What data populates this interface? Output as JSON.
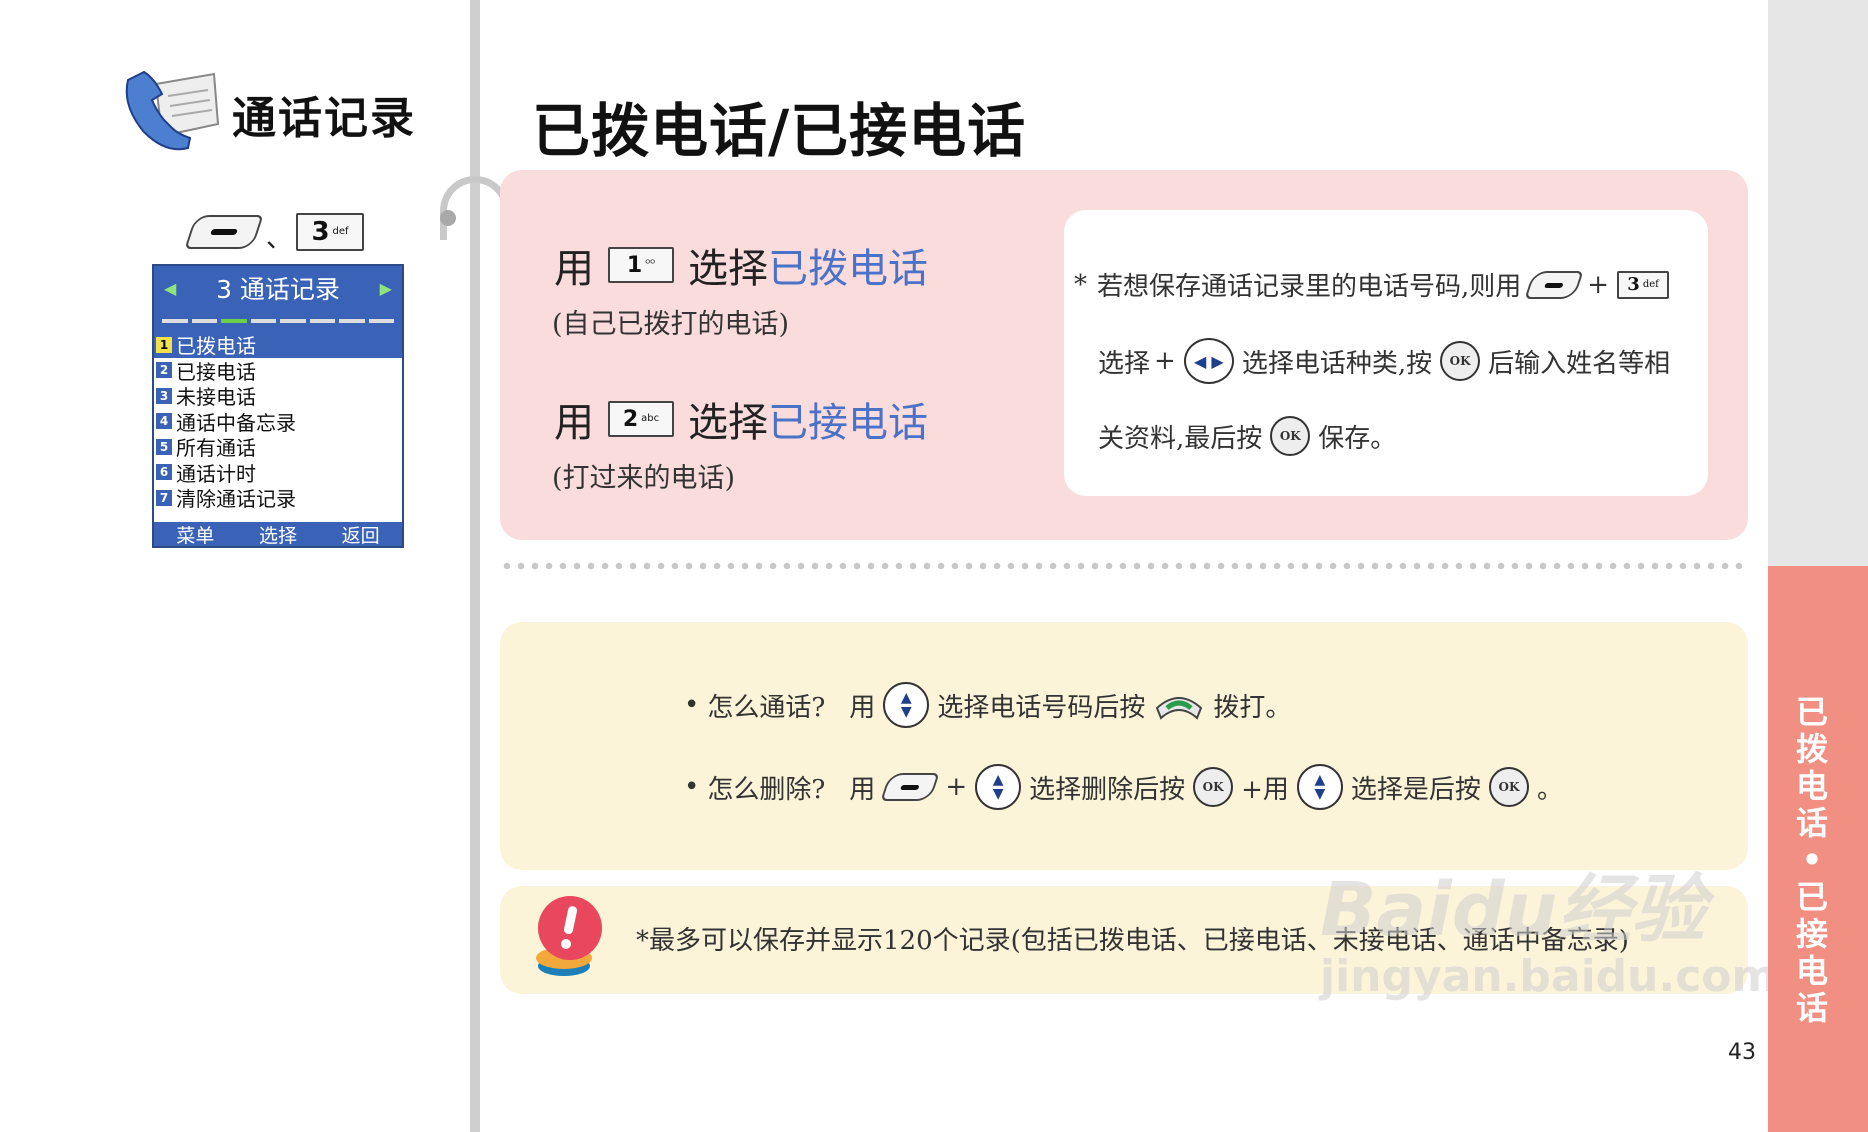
{
  "section": {
    "title": "通话记录",
    "key_separator": "、",
    "key_label": "3",
    "key_sub": "def"
  },
  "phone_screen": {
    "header": "3 通话记录",
    "items": [
      {
        "num": "1",
        "label": "已拨电话"
      },
      {
        "num": "2",
        "label": "已接电话"
      },
      {
        "num": "3",
        "label": "未接电话"
      },
      {
        "num": "4",
        "label": "通话中备忘录"
      },
      {
        "num": "5",
        "label": "所有通话"
      },
      {
        "num": "6",
        "label": "通话计时"
      },
      {
        "num": "7",
        "label": "清除通话记录"
      }
    ],
    "footer": [
      "菜单",
      "选择",
      "返回"
    ]
  },
  "page_title": "已拨电话/已接电话",
  "instructions": [
    {
      "use": "用",
      "key_num": "1",
      "key_sub": "ᴼᴼ",
      "select": "选择",
      "target": "已拨电话",
      "sub": "(自己已拨打的电话)"
    },
    {
      "use": "用",
      "key_num": "2",
      "key_sub": "abc",
      "select": "选择",
      "target": "已接电话",
      "sub": "(打过来的电话)"
    }
  ],
  "note": {
    "asterisk": "*",
    "l1a": "若想保存通话记录里的电话号码,则用",
    "plus": "+",
    "key_num": "3",
    "key_sub": "def",
    "l2a": "选择",
    "l2b": "选择电话种类,按",
    "l2c": "后输入姓名等相",
    "l3a": "关资料,最后按",
    "l3b": "保存。"
  },
  "bullets": {
    "b1": {
      "q": "怎么通话?",
      "use": "用",
      "a": "选择电话号码后按",
      "b": "拨打。"
    },
    "b2": {
      "q": "怎么删除?",
      "use": "用",
      "plus": "+",
      "a": "选择删除后按",
      "b": "+用",
      "c": "选择是后按",
      "d": "。"
    }
  },
  "ok_label": "OK",
  "tip": "*最多可以保存并显示120个记录(包括已拨电话、已接电话、未接电话、通话中备忘录)",
  "side_tab": [
    "已",
    "拨",
    "电",
    "话",
    "•",
    "已",
    "接",
    "电",
    "话"
  ],
  "page_number": "43",
  "watermark": {
    "brand": "Baidu经验",
    "url": "jingyan.baidu.com"
  },
  "colors": {
    "accent_blue": "#4a72c8",
    "pink_panel": "#fbdcdc",
    "cream_panel": "#fcf4d9",
    "side_tab": "#f08f82",
    "screen_blue": "#3a63b8"
  }
}
